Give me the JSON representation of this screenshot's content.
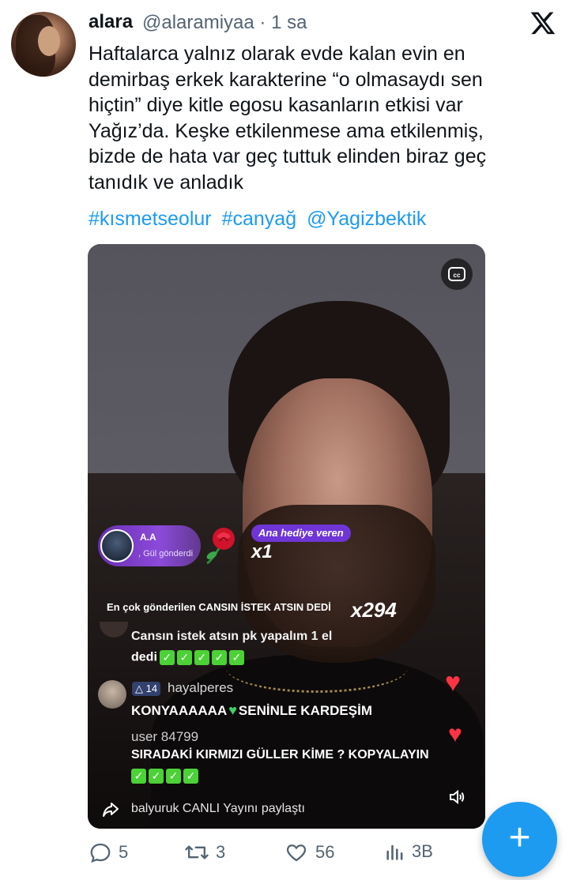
{
  "author": {
    "name": "alara",
    "handle_time": "@alaramiyaa · 1 sa"
  },
  "tweet": {
    "lines": [
      "Haftalarca yalnız olarak evde kalan evin en",
      "demirbaş erkek karakterine “o olmasaydı sen",
      "hiçtin” diye kitle egosu kasanların etkisi var",
      "Yağız’da. Keşke etkilenmese ama etkilenmiş,",
      "bizde de hata var geç tuttuk elinden biraz geç",
      "tanıdık ve anladık"
    ],
    "hashtags": [
      "#kısmetseolur",
      "#canyağ",
      "@Yagizbektik"
    ]
  },
  "live": {
    "gift": {
      "sender": "A.A",
      "action": ", Gül gönderdi",
      "count": "x1",
      "top_gifter_label": "Ana hediye veren"
    },
    "top_sender": {
      "text": "En çok gönderilen CANSIN İSTEK ATSIN DEDİ",
      "count": "x294"
    },
    "comments": [
      {
        "text_line1": "Cansın istek atsın pk yapalım 1 el",
        "text_line2": "dedi",
        "checks": 5
      },
      {
        "level": "14",
        "user": "hayalperes",
        "text_before": "KONYAAAAAA",
        "text_after": "SENİNLE KARDEŞİM"
      },
      {
        "user": "user 84799",
        "text": "SIRADAKİ KIRMIZI GÜLLER KİME ? KOPYALAYIN",
        "checks": 4
      }
    ],
    "share_text": "balyuruk CANLI Yayını paylaştı"
  },
  "actions": {
    "replies": "5",
    "reposts": "3",
    "likes": "56",
    "views": "3B"
  },
  "colors": {
    "link": "#1d9bf0",
    "muted": "#536471",
    "fab": "#1d9bf0"
  }
}
